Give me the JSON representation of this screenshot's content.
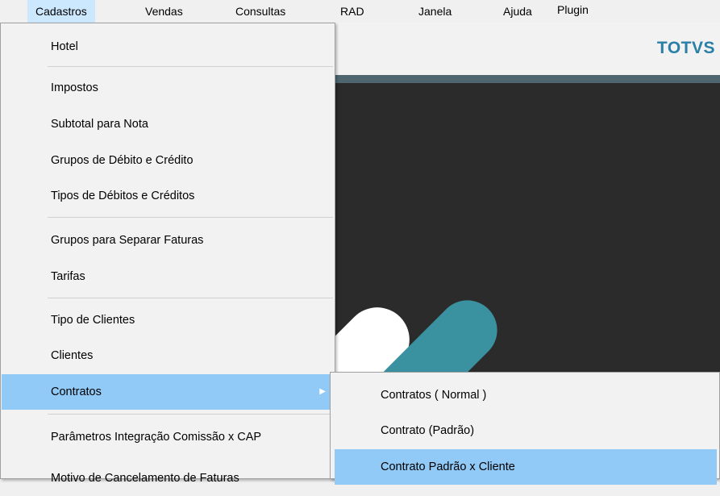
{
  "menubar": {
    "items": [
      "Cadastros",
      "Vendas",
      "Consultas",
      "RAD",
      "Janela",
      "Ajuda",
      "Plugin"
    ]
  },
  "brand": "TOTVS",
  "dropdown": {
    "items": [
      "Hotel",
      "Impostos",
      "Subtotal para Nota",
      "Grupos de Débito e Crédito",
      "Tipos de Débitos e Créditos",
      "Grupos para Separar Faturas",
      "Tarifas",
      "Tipo de Clientes",
      "Clientes",
      "Contratos",
      "Parâmetros Integração Comissão x CAP",
      "Motivo de Cancelamento de Faturas"
    ]
  },
  "submenu": {
    "items": [
      "Contratos ( Normal )",
      "Contrato (Padrão)",
      "Contrato Padrão x Cliente"
    ]
  },
  "colors": {
    "highlight": "#91c9f7",
    "menubar_active": "#cce8ff",
    "brand": "#2a7fa7",
    "teal_shape": "#3a91a0"
  }
}
